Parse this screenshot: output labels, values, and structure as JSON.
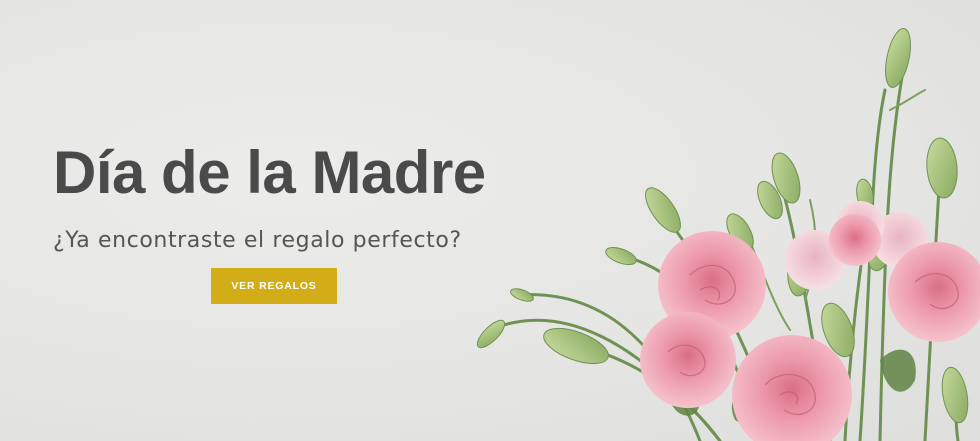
{
  "hero": {
    "title": "Día de la Madre",
    "subtitle": "¿Ya encontraste el regalo perfecto?",
    "cta_label": "VER REGALOS"
  },
  "colors": {
    "background": "#e6e6e4",
    "title": "#4a4a4a",
    "cta": "#d3ad17",
    "rose": "#e88fa3",
    "stem": "#6f9254"
  }
}
